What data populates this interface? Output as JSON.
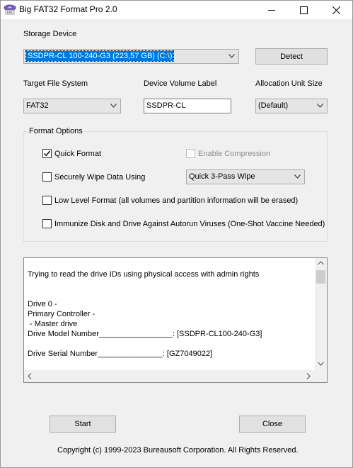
{
  "window": {
    "title": "Big FAT32 Format Pro 2.0"
  },
  "storage": {
    "label": "Storage Device",
    "selected": "SSDPR-CL 100-240-G3 (223,57 GB) (C:\\)",
    "detect_label": "Detect"
  },
  "filesystem": {
    "label": "Target File System",
    "selected": "FAT32"
  },
  "volume_label": {
    "label": "Device Volume Label",
    "value": "SSDPR-CL"
  },
  "allocation": {
    "label": "Allocation Unit Size",
    "selected": "(Default)"
  },
  "format_options": {
    "title": "Format Options",
    "quick_format": {
      "label": "Quick Format",
      "checked": true
    },
    "enable_compression": {
      "label": "Enable Compression",
      "checked": false,
      "enabled": false
    },
    "secure_wipe": {
      "label": "Securely Wipe Data Using",
      "checked": false
    },
    "wipe_method": "Quick 3-Pass Wipe",
    "low_level": {
      "label": "Low Level Format (all volumes and partition information will be erased)",
      "checked": false
    },
    "immunize": {
      "label": "Immunize Disk and Drive Against Autorun Viruses (One-Shot Vaccine Needed)",
      "checked": false
    }
  },
  "log": {
    "lines": [
      "Trying to read the drive IDs using physical access with admin rights",
      "Drive 0 -",
      "Primary Controller -",
      " - Master drive",
      "Drive Model Number_________________: [SSDPR-CL100-240-G3]",
      "Drive Serial Number_______________: [GZ7049022]"
    ]
  },
  "buttons": {
    "start": "Start",
    "close": "Close"
  },
  "footer": {
    "copyright": "Copyright (c) 1999-2023 Bureausoft Corporation. All Rights Reserved."
  },
  "colors": {
    "selection": "#0078d7",
    "window_bg": "#f0f0f0",
    "check_mark": "#000000"
  }
}
